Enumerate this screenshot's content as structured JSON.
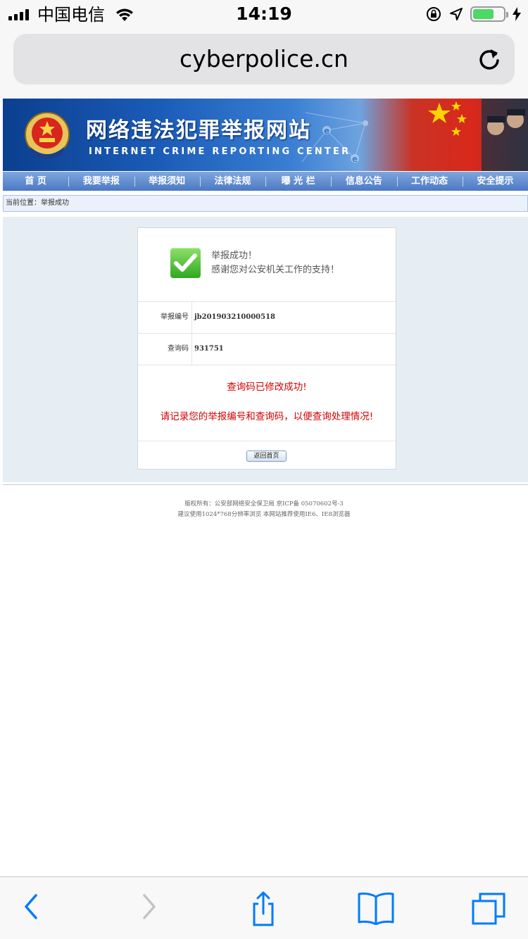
{
  "status_bar": {
    "carrier": "中国电信",
    "time": "14:19",
    "battery_level": 0.7,
    "icons": [
      "signal-icon",
      "wifi-icon",
      "orientation-lock-icon",
      "location-icon",
      "battery-icon",
      "charging-icon"
    ]
  },
  "browser": {
    "url": "cyberpolice.cn",
    "reload_icon": "reload-icon"
  },
  "banner": {
    "title": "网络违法犯罪举报网站",
    "subtitle": "INTERNET CRIME REPORTING CENTER",
    "emblem": "police-emblem"
  },
  "nav": {
    "items": [
      {
        "label": "首 页"
      },
      {
        "label": "我要举报"
      },
      {
        "label": "举报须知"
      },
      {
        "label": "法律法规"
      },
      {
        "label": "曝 光 栏"
      },
      {
        "label": "信息公告"
      },
      {
        "label": "工作动态"
      },
      {
        "label": "安全提示"
      }
    ]
  },
  "breadcrumb": "当前位置：举报成功",
  "result": {
    "title": "举报成功！",
    "message": "感谢您对公安机关工作的支持！",
    "icon": "check-icon",
    "report_number_label": "举报编号",
    "report_number": "jb201903210000518",
    "query_code_label": "查询码",
    "query_code": "931751",
    "notice_1": "查询码已修改成功!",
    "notice_2": "请记录您的举报编号和查询码，以便查询处理情况!",
    "back_button": "返回首页"
  },
  "footer": {
    "line_1": "版权所有：公安部网络安全保卫局 京ICP备 05070602号-3",
    "line_2": "建议使用1024*768分辨率浏览 本网站推荐使用IE6、IE8浏览器"
  },
  "toolbar": {
    "icons": [
      "back-icon",
      "forward-icon",
      "share-icon",
      "bookmarks-icon",
      "tabs-icon"
    ]
  },
  "colors": {
    "ios_blue": "#007aff",
    "nav_blue": "#4b79c4",
    "notice_red": "#d40000",
    "success_green": "#2fa81f"
  }
}
